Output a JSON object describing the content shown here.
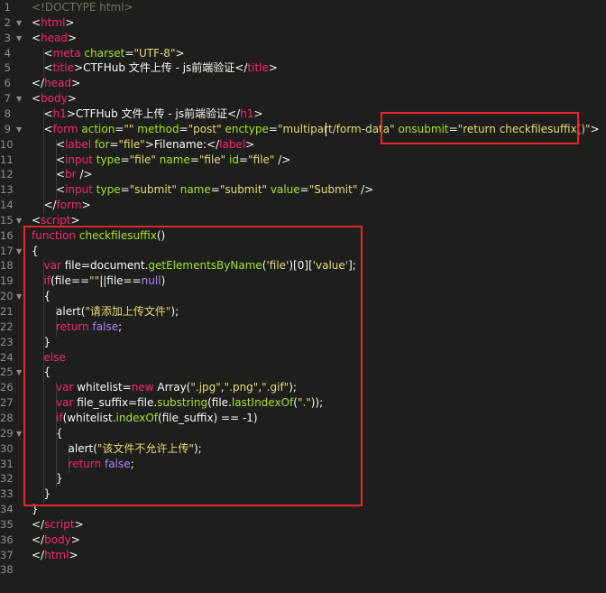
{
  "editor": {
    "lines": [
      {
        "n": "1",
        "fold": "",
        "ind": 0,
        "tok": [
          [
            "c",
            "<!DOCTYPE html>"
          ]
        ]
      },
      {
        "n": "2",
        "fold": "▼",
        "ind": 0,
        "tok": [
          [
            "w",
            "<"
          ],
          [
            "t",
            "html"
          ],
          [
            "w",
            ">"
          ]
        ]
      },
      {
        "n": "3",
        "fold": "▼",
        "ind": 0,
        "tok": [
          [
            "w",
            "<"
          ],
          [
            "t",
            "head"
          ],
          [
            "w",
            ">"
          ]
        ]
      },
      {
        "n": "4",
        "fold": "",
        "ind": 1,
        "tok": [
          [
            "w",
            "<"
          ],
          [
            "t",
            "meta"
          ],
          [
            "w",
            " "
          ],
          [
            "a",
            "charset"
          ],
          [
            "w",
            "="
          ],
          [
            "s",
            "\"UTF-8\""
          ],
          [
            "w",
            ">"
          ]
        ]
      },
      {
        "n": "5",
        "fold": "",
        "ind": 1,
        "tok": [
          [
            "w",
            "<"
          ],
          [
            "t",
            "title"
          ],
          [
            "w",
            ">CTFHub 文件上传 - js前端验证</"
          ],
          [
            "t",
            "title"
          ],
          [
            "w",
            ">"
          ]
        ]
      },
      {
        "n": "6",
        "fold": "",
        "ind": 0,
        "tok": [
          [
            "w",
            "</"
          ],
          [
            "t",
            "head"
          ],
          [
            "w",
            ">"
          ]
        ]
      },
      {
        "n": "7",
        "fold": "▼",
        "ind": 0,
        "tok": [
          [
            "w",
            "<"
          ],
          [
            "t",
            "body"
          ],
          [
            "w",
            ">"
          ]
        ]
      },
      {
        "n": "8",
        "fold": "",
        "ind": 1,
        "tok": [
          [
            "w",
            "<"
          ],
          [
            "t",
            "h1"
          ],
          [
            "w",
            ">CTFHub 文件上传 - js前端验证</"
          ],
          [
            "t",
            "h1"
          ],
          [
            "w",
            ">"
          ]
        ]
      },
      {
        "n": "9",
        "fold": "▼",
        "ind": 1,
        "tok": [
          [
            "w",
            "<"
          ],
          [
            "t",
            "form"
          ],
          [
            "w",
            " "
          ],
          [
            "a",
            "action"
          ],
          [
            "w",
            "="
          ],
          [
            "s",
            "\"\""
          ],
          [
            "w",
            " "
          ],
          [
            "a",
            "method"
          ],
          [
            "w",
            "="
          ],
          [
            "s",
            "\"post\""
          ],
          [
            "w",
            " "
          ],
          [
            "a",
            "enctype"
          ],
          [
            "w",
            "="
          ],
          [
            "s",
            "\"multipart/form-data\""
          ],
          [
            "w",
            " "
          ],
          [
            "a",
            "onsubmit"
          ],
          [
            "w",
            "="
          ],
          [
            "s",
            "\"return checkfilesuffix()\""
          ],
          [
            "w",
            ">"
          ]
        ]
      },
      {
        "n": "10",
        "fold": "",
        "ind": 2,
        "tok": [
          [
            "w",
            "<"
          ],
          [
            "t",
            "label"
          ],
          [
            "w",
            " "
          ],
          [
            "a",
            "for"
          ],
          [
            "w",
            "="
          ],
          [
            "s",
            "\"file\""
          ],
          [
            "w",
            ">Filename:</"
          ],
          [
            "t",
            "label"
          ],
          [
            "w",
            ">"
          ]
        ]
      },
      {
        "n": "11",
        "fold": "",
        "ind": 2,
        "tok": [
          [
            "w",
            "<"
          ],
          [
            "t",
            "input"
          ],
          [
            "w",
            " "
          ],
          [
            "a",
            "type"
          ],
          [
            "w",
            "="
          ],
          [
            "s",
            "\"file\""
          ],
          [
            "w",
            " "
          ],
          [
            "a",
            "name"
          ],
          [
            "w",
            "="
          ],
          [
            "s",
            "\"file\""
          ],
          [
            "w",
            " "
          ],
          [
            "a",
            "id"
          ],
          [
            "w",
            "="
          ],
          [
            "s",
            "\"file\""
          ],
          [
            "w",
            " />"
          ]
        ]
      },
      {
        "n": "12",
        "fold": "",
        "ind": 2,
        "tok": [
          [
            "w",
            "<"
          ],
          [
            "t",
            "br"
          ],
          [
            "w",
            " />"
          ]
        ]
      },
      {
        "n": "13",
        "fold": "",
        "ind": 2,
        "tok": [
          [
            "w",
            "<"
          ],
          [
            "t",
            "input"
          ],
          [
            "w",
            " "
          ],
          [
            "a",
            "type"
          ],
          [
            "w",
            "="
          ],
          [
            "s",
            "\"submit\""
          ],
          [
            "w",
            " "
          ],
          [
            "a",
            "name"
          ],
          [
            "w",
            "="
          ],
          [
            "s",
            "\"submit\""
          ],
          [
            "w",
            " "
          ],
          [
            "a",
            "value"
          ],
          [
            "w",
            "="
          ],
          [
            "s",
            "\"Submit\""
          ],
          [
            "w",
            " />"
          ]
        ]
      },
      {
        "n": "14",
        "fold": "",
        "ind": 1,
        "tok": [
          [
            "w",
            "</"
          ],
          [
            "t",
            "form"
          ],
          [
            "w",
            ">"
          ]
        ]
      },
      {
        "n": "15",
        "fold": "▼",
        "ind": 0,
        "tok": [
          [
            "w",
            "<"
          ],
          [
            "t",
            "script"
          ],
          [
            "w",
            ">"
          ]
        ]
      },
      {
        "n": "16",
        "fold": "",
        "ind": 0,
        "tok": [
          [
            "k",
            "function"
          ],
          [
            "w",
            " "
          ],
          [
            "f",
            "checkfilesuffix"
          ],
          [
            "w",
            "()"
          ]
        ]
      },
      {
        "n": "17",
        "fold": "▼",
        "ind": 0,
        "tok": [
          [
            "w",
            "{"
          ]
        ]
      },
      {
        "n": "18",
        "fold": "",
        "ind": 1,
        "tok": [
          [
            "k",
            "var"
          ],
          [
            "w",
            " file="
          ],
          [
            "w",
            "document."
          ],
          [
            "f",
            "getElementsByName"
          ],
          [
            "w",
            "("
          ],
          [
            "s",
            "'file'"
          ],
          [
            "w",
            ")[0]["
          ],
          [
            "s",
            "'value'"
          ],
          [
            "w",
            "];"
          ]
        ]
      },
      {
        "n": "19",
        "fold": "",
        "ind": 1,
        "tok": [
          [
            "k",
            "if"
          ],
          [
            "w",
            "(file=="
          ],
          [
            "s",
            "\"\""
          ],
          [
            "w",
            "||file=="
          ],
          [
            "b",
            "null"
          ],
          [
            "w",
            ")"
          ]
        ]
      },
      {
        "n": "20",
        "fold": "▼",
        "ind": 1,
        "tok": [
          [
            "w",
            "{"
          ]
        ]
      },
      {
        "n": "21",
        "fold": "",
        "ind": 2,
        "tok": [
          [
            "w",
            "alert("
          ],
          [
            "s",
            "\"请添加上传文件\""
          ],
          [
            "w",
            ");"
          ]
        ]
      },
      {
        "n": "22",
        "fold": "",
        "ind": 2,
        "tok": [
          [
            "k",
            "return"
          ],
          [
            "w",
            " "
          ],
          [
            "b",
            "false"
          ],
          [
            "w",
            ";"
          ]
        ]
      },
      {
        "n": "23",
        "fold": "",
        "ind": 1,
        "tok": [
          [
            "w",
            "}"
          ]
        ]
      },
      {
        "n": "24",
        "fold": "",
        "ind": 1,
        "tok": [
          [
            "k",
            "else"
          ]
        ]
      },
      {
        "n": "25",
        "fold": "▼",
        "ind": 1,
        "tok": [
          [
            "w",
            "{"
          ]
        ]
      },
      {
        "n": "26",
        "fold": "",
        "ind": 2,
        "tok": [
          [
            "k",
            "var"
          ],
          [
            "w",
            " whitelist="
          ],
          [
            "k",
            "new"
          ],
          [
            "w",
            " Array("
          ],
          [
            "s",
            "\".jpg\""
          ],
          [
            "w",
            ","
          ],
          [
            "s",
            "\".png\""
          ],
          [
            "w",
            ","
          ],
          [
            "s",
            "\".gif\""
          ],
          [
            "w",
            ");"
          ]
        ]
      },
      {
        "n": "27",
        "fold": "",
        "ind": 2,
        "tok": [
          [
            "k",
            "var"
          ],
          [
            "w",
            " file_suffix=file."
          ],
          [
            "f",
            "substring"
          ],
          [
            "w",
            "(file."
          ],
          [
            "f",
            "lastIndexOf"
          ],
          [
            "w",
            "("
          ],
          [
            "s",
            "\".\""
          ],
          [
            "w",
            "));"
          ]
        ]
      },
      {
        "n": "28",
        "fold": "",
        "ind": 2,
        "tok": [
          [
            "k",
            "if"
          ],
          [
            "w",
            "(whitelist."
          ],
          [
            "f",
            "indexOf"
          ],
          [
            "w",
            "(file_suffix) == -1)"
          ]
        ]
      },
      {
        "n": "29",
        "fold": "▼",
        "ind": 2,
        "tok": [
          [
            "w",
            "{"
          ]
        ]
      },
      {
        "n": "30",
        "fold": "",
        "ind": 3,
        "tok": [
          [
            "w",
            "alert("
          ],
          [
            "s",
            "\"该文件不允许上传\""
          ],
          [
            "w",
            ");"
          ]
        ]
      },
      {
        "n": "31",
        "fold": "",
        "ind": 3,
        "tok": [
          [
            "k",
            "return"
          ],
          [
            "w",
            " "
          ],
          [
            "b",
            "false"
          ],
          [
            "w",
            ";"
          ]
        ]
      },
      {
        "n": "32",
        "fold": "",
        "ind": 2,
        "tok": [
          [
            "w",
            "}"
          ]
        ]
      },
      {
        "n": "33",
        "fold": "",
        "ind": 1,
        "tok": [
          [
            "w",
            "}"
          ]
        ]
      },
      {
        "n": "34",
        "fold": "",
        "ind": 0,
        "tok": [
          [
            "w",
            "}"
          ]
        ]
      },
      {
        "n": "35",
        "fold": "",
        "ind": 0,
        "tok": [
          [
            "w",
            "</"
          ],
          [
            "t",
            "script"
          ],
          [
            "w",
            ">"
          ]
        ]
      },
      {
        "n": "36",
        "fold": "",
        "ind": 0,
        "tok": [
          [
            "w",
            "</"
          ],
          [
            "t",
            "body"
          ],
          [
            "w",
            ">"
          ]
        ]
      },
      {
        "n": "37",
        "fold": "",
        "ind": 0,
        "tok": [
          [
            "w",
            "</"
          ],
          [
            "t",
            "html"
          ],
          [
            "w",
            ">"
          ]
        ]
      },
      {
        "n": "38",
        "fold": "",
        "ind": 0,
        "tok": []
      }
    ]
  },
  "colors": {
    "background": "#1e1f1c",
    "highlight_box": "#e8262b",
    "tag": "#f92672",
    "attribute": "#a6e22e",
    "string": "#e6db74",
    "keyword": "#f92672",
    "constant": "#ae81ff",
    "comment": "#75715e",
    "text": "#f8f8f2"
  }
}
